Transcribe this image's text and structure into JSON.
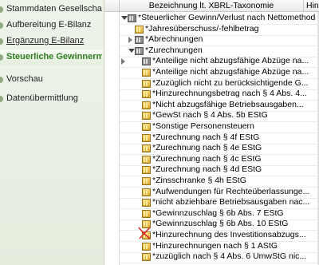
{
  "sidebar": {
    "items": [
      {
        "label": "Stammdaten Gesellschafter",
        "state": "normal"
      },
      {
        "label": "Aufbereitung E-Bilanz",
        "state": "normal"
      },
      {
        "label": "Ergänzung E-Bilanz",
        "state": "underlined"
      },
      {
        "label": "Steuerliche Gewinnermi...",
        "state": "active"
      },
      {
        "label": "Vorschau",
        "state": "normal"
      },
      {
        "label": "Datenübermittlung",
        "state": "normal"
      }
    ]
  },
  "tree": {
    "columns": {
      "main": "Bezeichnung lt. XBRL-Taxonomie",
      "next": "Hin"
    },
    "rows": [
      {
        "text": "*Steuerlicher Gewinn/Verlust nach Nettomethode",
        "level": 0,
        "expander": "open",
        "icon": "folder"
      },
      {
        "text": "*Jahresüberschuss/-fehlbetrag",
        "level": 1,
        "expander": "none",
        "icon": "doc"
      },
      {
        "text": "*Abrechnungen",
        "level": 1,
        "expander": "closed",
        "icon": "folder"
      },
      {
        "text": "*Zurechnungen",
        "level": 1,
        "expander": "open",
        "icon": "folder"
      },
      {
        "text": "*Anteilige nicht abzugsfähige Abzüge na...",
        "level": 2,
        "expander": "closed",
        "icon": "folder"
      },
      {
        "text": "*Anteilige nicht abzugsfähige Abzüge na...",
        "level": 2,
        "expander": "none",
        "icon": "doc"
      },
      {
        "text": "*Zuzüglich nicht zu berücksichtigende G...",
        "level": 2,
        "expander": "none",
        "icon": "doc"
      },
      {
        "text": "*Hinzurechnungsbetrag nach § 4 Abs. 4...",
        "level": 2,
        "expander": "none",
        "icon": "doc"
      },
      {
        "text": "*Nicht abzugsfähige Betriebsausgaben...",
        "level": 2,
        "expander": "none",
        "icon": "doc"
      },
      {
        "text": "*GewSt nach § 4 Abs. 5b EStG",
        "level": 2,
        "expander": "none",
        "icon": "doc"
      },
      {
        "text": "*Sonstige Personensteuern",
        "level": 2,
        "expander": "none",
        "icon": "doc"
      },
      {
        "text": "*Zurechnung nach § 4f EStG",
        "level": 2,
        "expander": "none",
        "icon": "doc"
      },
      {
        "text": "*Zurechnung nach § 4e EStG",
        "level": 2,
        "expander": "none",
        "icon": "doc"
      },
      {
        "text": "*Zurechnung nach § 4c EStG",
        "level": 2,
        "expander": "none",
        "icon": "doc"
      },
      {
        "text": "*Zurechnung nach § 4d EStG",
        "level": 2,
        "expander": "none",
        "icon": "doc"
      },
      {
        "text": "*Zinsschranke § 4h EStG",
        "level": 2,
        "expander": "none",
        "icon": "doc"
      },
      {
        "text": "*Aufwendungen für Rechteüberlassunge...",
        "level": 2,
        "expander": "none",
        "icon": "doc"
      },
      {
        "text": "*nicht abziehbare Betriebsausgaben nac...",
        "level": 2,
        "expander": "none",
        "icon": "doc"
      },
      {
        "text": "*Gewinnzuschlag § 6b Abs. 7 EStG",
        "level": 2,
        "expander": "none",
        "icon": "doc"
      },
      {
        "text": "*Gewinnzuschlag § 6b Abs. 10 EStG",
        "level": 2,
        "expander": "none",
        "icon": "doc"
      },
      {
        "text": "*Hinzurechnung des Investitionsabzugs...",
        "level": 2,
        "expander": "none",
        "icon": "doc"
      },
      {
        "text": "*Hinzurechnungen nach § 1 AStG",
        "level": 2,
        "expander": "none",
        "icon": "doc"
      },
      {
        "text": "*zuzüglich nach § 4 Abs. 6 UmwStG nic...",
        "level": 2,
        "expander": "none",
        "icon": "doc"
      }
    ]
  },
  "colors": {
    "active_nav": "#2e7d20",
    "annotation_mark": "#e02020"
  }
}
